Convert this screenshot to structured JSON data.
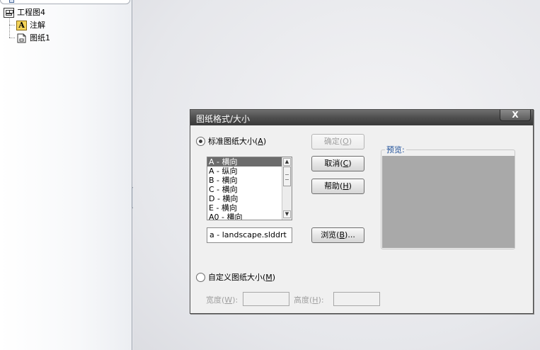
{
  "feature_tree": {
    "root_label": "工程图4",
    "items": [
      {
        "label": "注解",
        "icon": "annotation-icon"
      },
      {
        "label": "图纸1",
        "icon": "sheet-icon"
      }
    ]
  },
  "dialog": {
    "title": "图纸格式/大小",
    "close_label": "X",
    "standard_radio": {
      "label_prefix": "标准图纸大小(",
      "key": "A",
      "label_suffix": ")",
      "checked": true
    },
    "paper_sizes": [
      "A - 横向",
      "A - 纵向",
      "B - 横向",
      "C - 横向",
      "D - 横向",
      "E - 横向",
      "A0 - 横向"
    ],
    "selected_paper_size": "A - 横向",
    "format_file": "a - landscape.slddrt",
    "buttons": {
      "ok": {
        "prefix": "确定(",
        "key": "O",
        "suffix": ")"
      },
      "cancel": {
        "prefix": "取消(",
        "key": "C",
        "suffix": ")"
      },
      "help": {
        "prefix": "帮助(",
        "key": "H",
        "suffix": ")"
      },
      "browse": {
        "prefix": "浏览(",
        "key": "B",
        "suffix": ")..."
      }
    },
    "preview_label": "预览:",
    "custom_radio": {
      "label_prefix": "自定义图纸大小(",
      "key": "M",
      "label_suffix": ")",
      "checked": false
    },
    "width": {
      "prefix": "宽度(",
      "key": "W",
      "suffix": "):",
      "value": ""
    },
    "height": {
      "prefix": "高度(",
      "key": "H",
      "suffix": "):",
      "value": ""
    }
  }
}
